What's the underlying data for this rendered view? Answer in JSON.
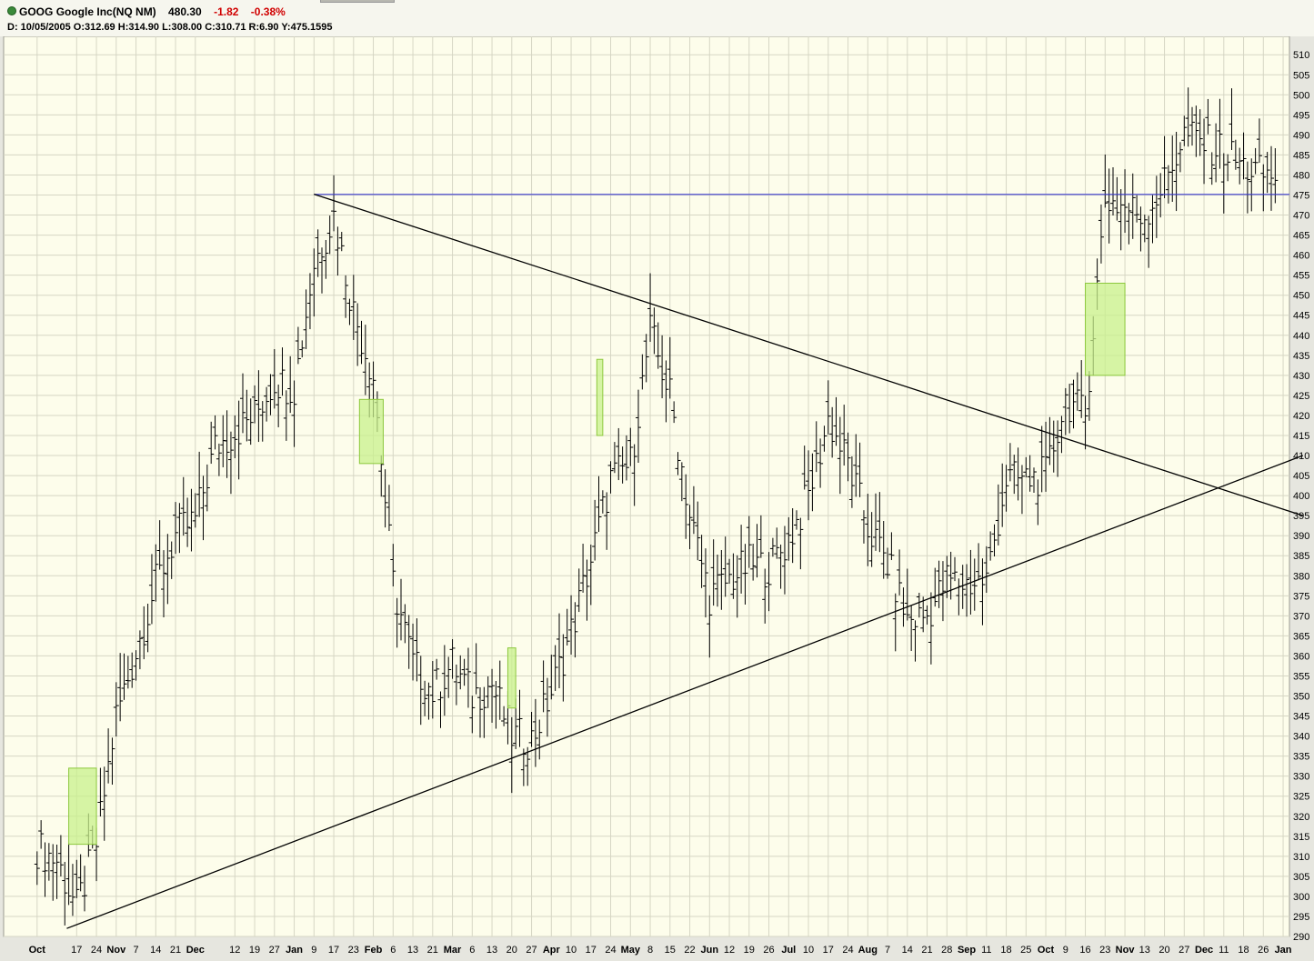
{
  "header": {
    "symbol": "GOOG",
    "name": "Google Inc(NQ NM)",
    "last": "480.30",
    "change": "-1.82",
    "change_pct": "-0.38%",
    "d_label": "D:",
    "d_value": "10/05/2005",
    "o_label": "O:",
    "o_value": "312.69",
    "h_label": "H:",
    "h_value": "314.90",
    "l_label": "L:",
    "l_value": "308.00",
    "c_label": "C:",
    "c_value": "310.71",
    "r_label": "R:",
    "r_value": "6.90",
    "y_label": "Y:",
    "y_value": "475.1595"
  },
  "colors": {
    "background": "#fdfdeb",
    "grid": "#d6d6c4",
    "bars": "#000000",
    "boxes": "#c8f08c",
    "horizontal_line": "#3b3bd0",
    "trend_lines": "#000000",
    "negative": "#d00000"
  },
  "chart_data": {
    "type": "ohlc",
    "y_range": [
      290,
      513
    ],
    "y_ticks": [
      290,
      295,
      300,
      305,
      310,
      315,
      320,
      325,
      330,
      335,
      340,
      345,
      350,
      355,
      360,
      365,
      370,
      375,
      380,
      385,
      390,
      395,
      400,
      405,
      410,
      415,
      420,
      425,
      430,
      435,
      440,
      445,
      450,
      455,
      460,
      465,
      470,
      475,
      480,
      485,
      490,
      495,
      500,
      505,
      510
    ],
    "x_ticks": [
      {
        "label": "Oct",
        "bold": true,
        "week": 0
      },
      {
        "label": "17",
        "week": 2
      },
      {
        "label": "24",
        "week": 3
      },
      {
        "label": "Nov",
        "bold": true,
        "week": 4
      },
      {
        "label": "7",
        "week": 5
      },
      {
        "label": "14",
        "week": 6
      },
      {
        "label": "21",
        "week": 7
      },
      {
        "label": "Dec",
        "bold": true,
        "week": 8
      },
      {
        "label": "12",
        "week": 10
      },
      {
        "label": "19",
        "week": 11
      },
      {
        "label": "27",
        "week": 12
      },
      {
        "label": "Jan",
        "bold": true,
        "week": 13
      },
      {
        "label": "9",
        "week": 14
      },
      {
        "label": "17",
        "week": 15
      },
      {
        "label": "23",
        "week": 16
      },
      {
        "label": "Feb",
        "bold": true,
        "week": 17
      },
      {
        "label": "6",
        "week": 18
      },
      {
        "label": "13",
        "week": 19
      },
      {
        "label": "21",
        "week": 20
      },
      {
        "label": "Mar",
        "bold": true,
        "week": 21
      },
      {
        "label": "6",
        "week": 22
      },
      {
        "label": "13",
        "week": 23
      },
      {
        "label": "20",
        "week": 24
      },
      {
        "label": "27",
        "week": 25
      },
      {
        "label": "Apr",
        "bold": true,
        "week": 26
      },
      {
        "label": "10",
        "week": 27
      },
      {
        "label": "17",
        "week": 28
      },
      {
        "label": "24",
        "week": 29
      },
      {
        "label": "May",
        "bold": true,
        "week": 30
      },
      {
        "label": "8",
        "week": 31
      },
      {
        "label": "15",
        "week": 32
      },
      {
        "label": "22",
        "week": 33
      },
      {
        "label": "Jun",
        "bold": true,
        "week": 34
      },
      {
        "label": "12",
        "week": 35
      },
      {
        "label": "19",
        "week": 36
      },
      {
        "label": "26",
        "week": 37
      },
      {
        "label": "Jul",
        "bold": true,
        "week": 38
      },
      {
        "label": "10",
        "week": 39
      },
      {
        "label": "17",
        "week": 40
      },
      {
        "label": "24",
        "week": 41
      },
      {
        "label": "Aug",
        "bold": true,
        "week": 42
      },
      {
        "label": "7",
        "week": 43
      },
      {
        "label": "14",
        "week": 44
      },
      {
        "label": "21",
        "week": 45
      },
      {
        "label": "28",
        "week": 46
      },
      {
        "label": "Sep",
        "bold": true,
        "week": 47
      },
      {
        "label": "11",
        "week": 48
      },
      {
        "label": "18",
        "week": 49
      },
      {
        "label": "25",
        "week": 50
      },
      {
        "label": "Oct",
        "bold": true,
        "week": 51
      },
      {
        "label": "9",
        "week": 52
      },
      {
        "label": "16",
        "week": 53
      },
      {
        "label": "23",
        "week": 54
      },
      {
        "label": "Nov",
        "bold": true,
        "week": 55
      },
      {
        "label": "13",
        "week": 56
      },
      {
        "label": "20",
        "week": 57
      },
      {
        "label": "27",
        "week": 58
      },
      {
        "label": "Dec",
        "bold": true,
        "week": 59
      },
      {
        "label": "11",
        "week": 60
      },
      {
        "label": "18",
        "week": 61
      },
      {
        "label": "26",
        "week": 62
      },
      {
        "label": "Jan",
        "bold": true,
        "week": 63
      }
    ],
    "closes": [
      [
        0,
        312
      ],
      [
        1,
        309
      ],
      [
        2,
        297
      ],
      [
        3,
        313
      ],
      [
        4,
        345
      ],
      [
        5,
        361
      ],
      [
        6,
        378
      ],
      [
        7,
        390
      ],
      [
        8,
        394
      ],
      [
        9,
        412
      ],
      [
        10,
        416
      ],
      [
        11,
        420
      ],
      [
        12,
        429
      ],
      [
        13,
        427
      ],
      [
        14,
        458
      ],
      [
        15,
        470
      ],
      [
        16,
        446
      ],
      [
        17,
        430
      ],
      [
        18,
        378
      ],
      [
        19,
        358
      ],
      [
        20,
        351
      ],
      [
        21,
        358
      ],
      [
        22,
        350
      ],
      [
        23,
        353
      ],
      [
        24,
        340
      ],
      [
        25,
        339
      ],
      [
        26,
        351
      ],
      [
        27,
        366
      ],
      [
        28,
        384
      ],
      [
        29,
        404
      ],
      [
        30,
        408
      ],
      [
        31,
        441
      ],
      [
        32,
        425
      ],
      [
        33,
        395
      ],
      [
        34,
        375
      ],
      [
        35,
        379
      ],
      [
        36,
        383
      ],
      [
        37,
        382
      ],
      [
        38,
        389
      ],
      [
        39,
        400
      ],
      [
        40,
        419
      ],
      [
        41,
        408
      ],
      [
        42,
        392
      ],
      [
        43,
        383
      ],
      [
        44,
        369
      ],
      [
        45,
        370
      ],
      [
        46,
        379
      ],
      [
        47,
        378
      ],
      [
        48,
        379
      ],
      [
        49,
        404
      ],
      [
        50,
        404
      ],
      [
        51,
        405
      ],
      [
        52,
        424
      ],
      [
        53,
        420
      ],
      [
        54,
        474
      ],
      [
        55,
        472
      ],
      [
        56,
        470
      ],
      [
        57,
        478
      ],
      [
        58,
        490
      ],
      [
        59,
        488
      ],
      [
        60,
        486
      ],
      [
        61,
        482
      ],
      [
        62,
        480
      ]
    ],
    "green_boxes": [
      {
        "week_start": 1.6,
        "week_end": 3.0,
        "low": 313,
        "high": 332
      },
      {
        "week_start": 16.3,
        "week_end": 17.5,
        "low": 408,
        "high": 424
      },
      {
        "week_start": 23.8,
        "week_end": 24.2,
        "low": 347,
        "high": 362
      },
      {
        "week_start": 28.3,
        "week_end": 28.6,
        "low": 415,
        "high": 434
      },
      {
        "week_start": 53.0,
        "week_end": 55.0,
        "low": 430,
        "high": 453
      }
    ],
    "horizontal_line": {
      "value": 475.1595,
      "week_start": 14.0
    },
    "trend_lines": [
      {
        "points": [
          [
            14.0,
            475.2
          ],
          [
            64,
            395
          ]
        ]
      },
      {
        "points": [
          [
            1.5,
            292
          ],
          [
            64,
            410
          ]
        ]
      }
    ]
  }
}
